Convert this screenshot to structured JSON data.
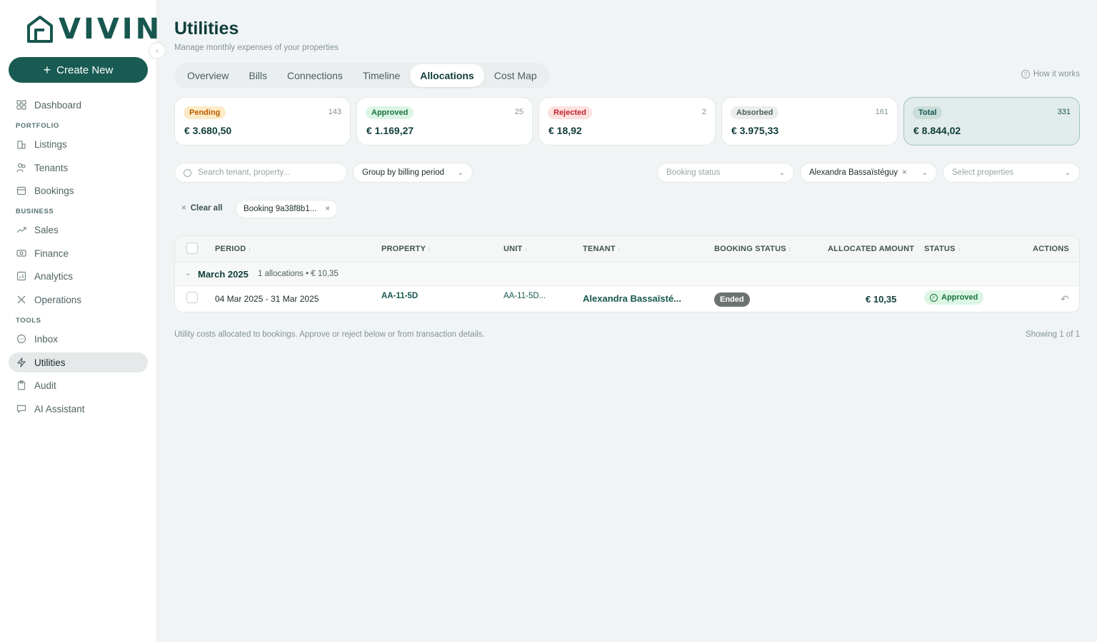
{
  "app": {
    "brand": "VIVIN",
    "accent": "#195b52",
    "create_label": "Create New"
  },
  "sidebar": {
    "items": [
      {
        "label": "Dashboard",
        "icon": "grid-icon"
      },
      {
        "section": "PORTFOLIO"
      },
      {
        "label": "Listings",
        "icon": "building-icon"
      },
      {
        "label": "Tenants",
        "icon": "users-icon"
      },
      {
        "label": "Bookings",
        "icon": "calendar-icon"
      },
      {
        "section": "BUSINESS"
      },
      {
        "label": "Sales",
        "icon": "trending-up-icon"
      },
      {
        "label": "Finance",
        "icon": "banknote-icon"
      },
      {
        "label": "Analytics",
        "icon": "bar-chart-icon"
      },
      {
        "label": "Operations",
        "icon": "tools-icon"
      },
      {
        "section": "TOOLS"
      },
      {
        "label": "Inbox",
        "icon": "message-icon"
      },
      {
        "label": "Utilities",
        "icon": "bolt-icon",
        "active": true
      },
      {
        "label": "Audit",
        "icon": "clipboard-icon"
      },
      {
        "label": "AI Assistant",
        "icon": "chat-icon"
      }
    ],
    "sections": {
      "portfolio": "PORTFOLIO",
      "business": "BUSINESS",
      "tools": "TOOLS"
    },
    "labels": {
      "dashboard": "Dashboard",
      "listings": "Listings",
      "tenants": "Tenants",
      "bookings": "Bookings",
      "sales": "Sales",
      "finance": "Finance",
      "analytics": "Analytics",
      "operations": "Operations",
      "inbox": "Inbox",
      "utilities": "Utilities",
      "audit": "Audit",
      "ai_assistant": "AI Assistant"
    }
  },
  "header": {
    "title": "Utilities",
    "subtitle": "Manage monthly expenses of your properties",
    "how_it_works": "How it works"
  },
  "tabs": [
    "Overview",
    "Bills",
    "Connections",
    "Timeline",
    "Allocations",
    "Cost Map"
  ],
  "active_tab": "Allocations",
  "stats": {
    "pending": {
      "label": "Pending",
      "count": "143",
      "amount": "€ 3.680,50",
      "color": "#b85c00",
      "bg": "#fdebc7"
    },
    "approved": {
      "label": "Approved",
      "count": "25",
      "amount": "€ 1.169,27",
      "color": "#19743f",
      "bg": "#dcf5e5"
    },
    "rejected": {
      "label": "Rejected",
      "count": "2",
      "amount": "€ 18,92",
      "color": "#c0262d",
      "bg": "#fde1e1"
    },
    "absorbed": {
      "label": "Absorbed",
      "count": "161",
      "amount": "€ 3.975,33",
      "color": "#4c5e5e",
      "bg": "#eceeee"
    },
    "total": {
      "label": "Total",
      "count": "331",
      "amount": "€ 8.844,02",
      "color": "#17574f",
      "bg": "#c9ddd9"
    }
  },
  "filters": {
    "search_placeholder": "Search tenant, property...",
    "group_by": "Group by billing period",
    "booking_status_placeholder": "Booking status",
    "tenant_selected": "Alexandra Bassaïstéguy",
    "properties_placeholder": "Select properties"
  },
  "active_filters": {
    "clear_all": "Clear all",
    "chips": [
      "Booking 9a38f8b1..."
    ]
  },
  "table": {
    "columns": [
      "PERIOD",
      "PROPERTY",
      "UNIT",
      "TENANT",
      "BOOKING STATUS",
      "ALLOCATED AMOUNT",
      "STATUS",
      "ACTIONS"
    ],
    "groups": [
      {
        "title": "March 2025",
        "meta": "1 allocations • € 10,35",
        "rows": [
          {
            "period": "04 Mar 2025 - 31 Mar 2025",
            "property": "AA-11-5D",
            "unit": "AA-11-5D...",
            "tenant": "Alexandra Bassaïsté...",
            "booking_status": "Ended",
            "amount": "€ 10,35",
            "status": "Approved"
          }
        ]
      }
    ]
  },
  "footer": {
    "note": "Utility costs allocated to bookings. Approve or reject below or from transaction details.",
    "count": "Showing 1 of 1"
  }
}
